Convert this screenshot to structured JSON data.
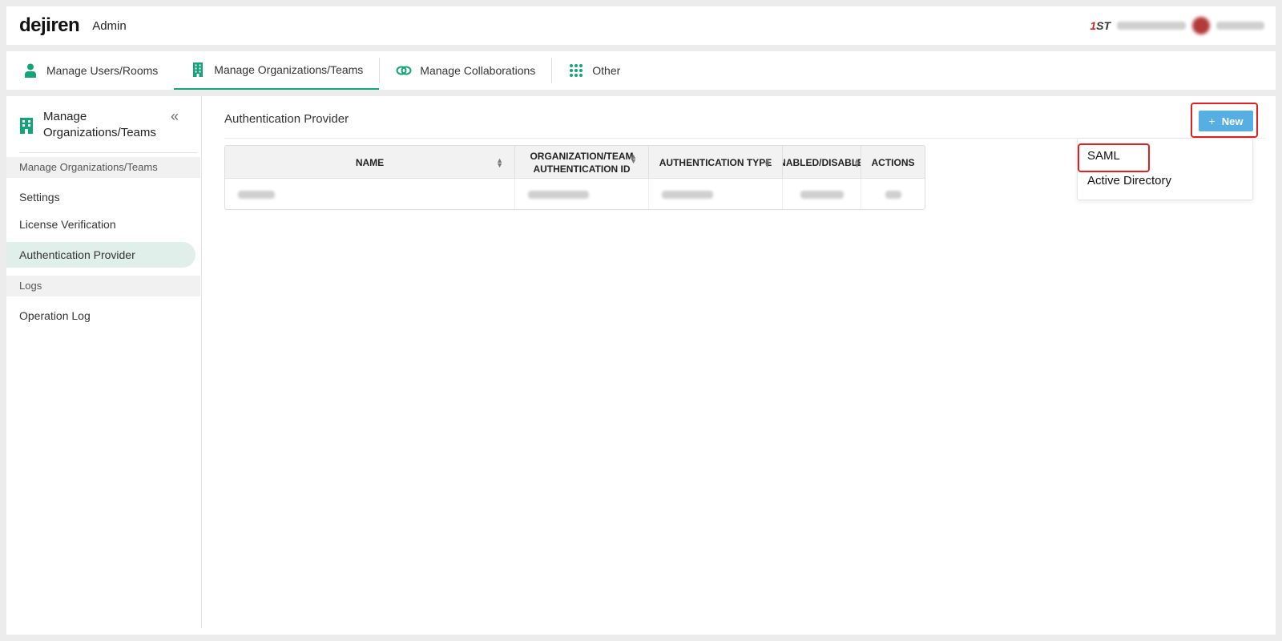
{
  "header": {
    "logo": "dejiren",
    "app_name": "Admin",
    "brand_badge_one": "1",
    "brand_badge_rest": "ST"
  },
  "tabs": [
    {
      "label": "Manage Users/Rooms",
      "icon": "user-icon"
    },
    {
      "label": "Manage Organizations/Teams",
      "icon": "building-icon"
    },
    {
      "label": "Manage Collaborations",
      "icon": "link-icon"
    },
    {
      "label": "Other",
      "icon": "grid-dots-icon"
    }
  ],
  "sidebar": {
    "title": "Manage Organizations/Teams",
    "collapse_glyph": "«",
    "sections": [
      {
        "label": "Manage Organizations/Teams"
      },
      {
        "label": "Logs"
      }
    ],
    "items": [
      {
        "label": "Settings"
      },
      {
        "label": "License Verification"
      },
      {
        "label": "Authentication Provider"
      },
      {
        "label": "Operation Log"
      }
    ]
  },
  "main": {
    "title": "Authentication Provider",
    "new_button": {
      "plus": "+",
      "label": "New"
    },
    "dropdown": [
      {
        "label": "SAML"
      },
      {
        "label": "Active Directory"
      }
    ],
    "table": {
      "columns": [
        {
          "label": "NAME"
        },
        {
          "label": "ORGANIZATION/TEAM AUTHENTICATION ID"
        },
        {
          "label": "AUTHENTICATION TYPE"
        },
        {
          "label": "ENABLED/DISABLED"
        },
        {
          "label": "ACTIONS"
        }
      ]
    }
  },
  "colors": {
    "accent": "#15a37a",
    "button": "#56aee3",
    "highlight": "#e02020",
    "active_item_bg": "#e0efe9"
  }
}
